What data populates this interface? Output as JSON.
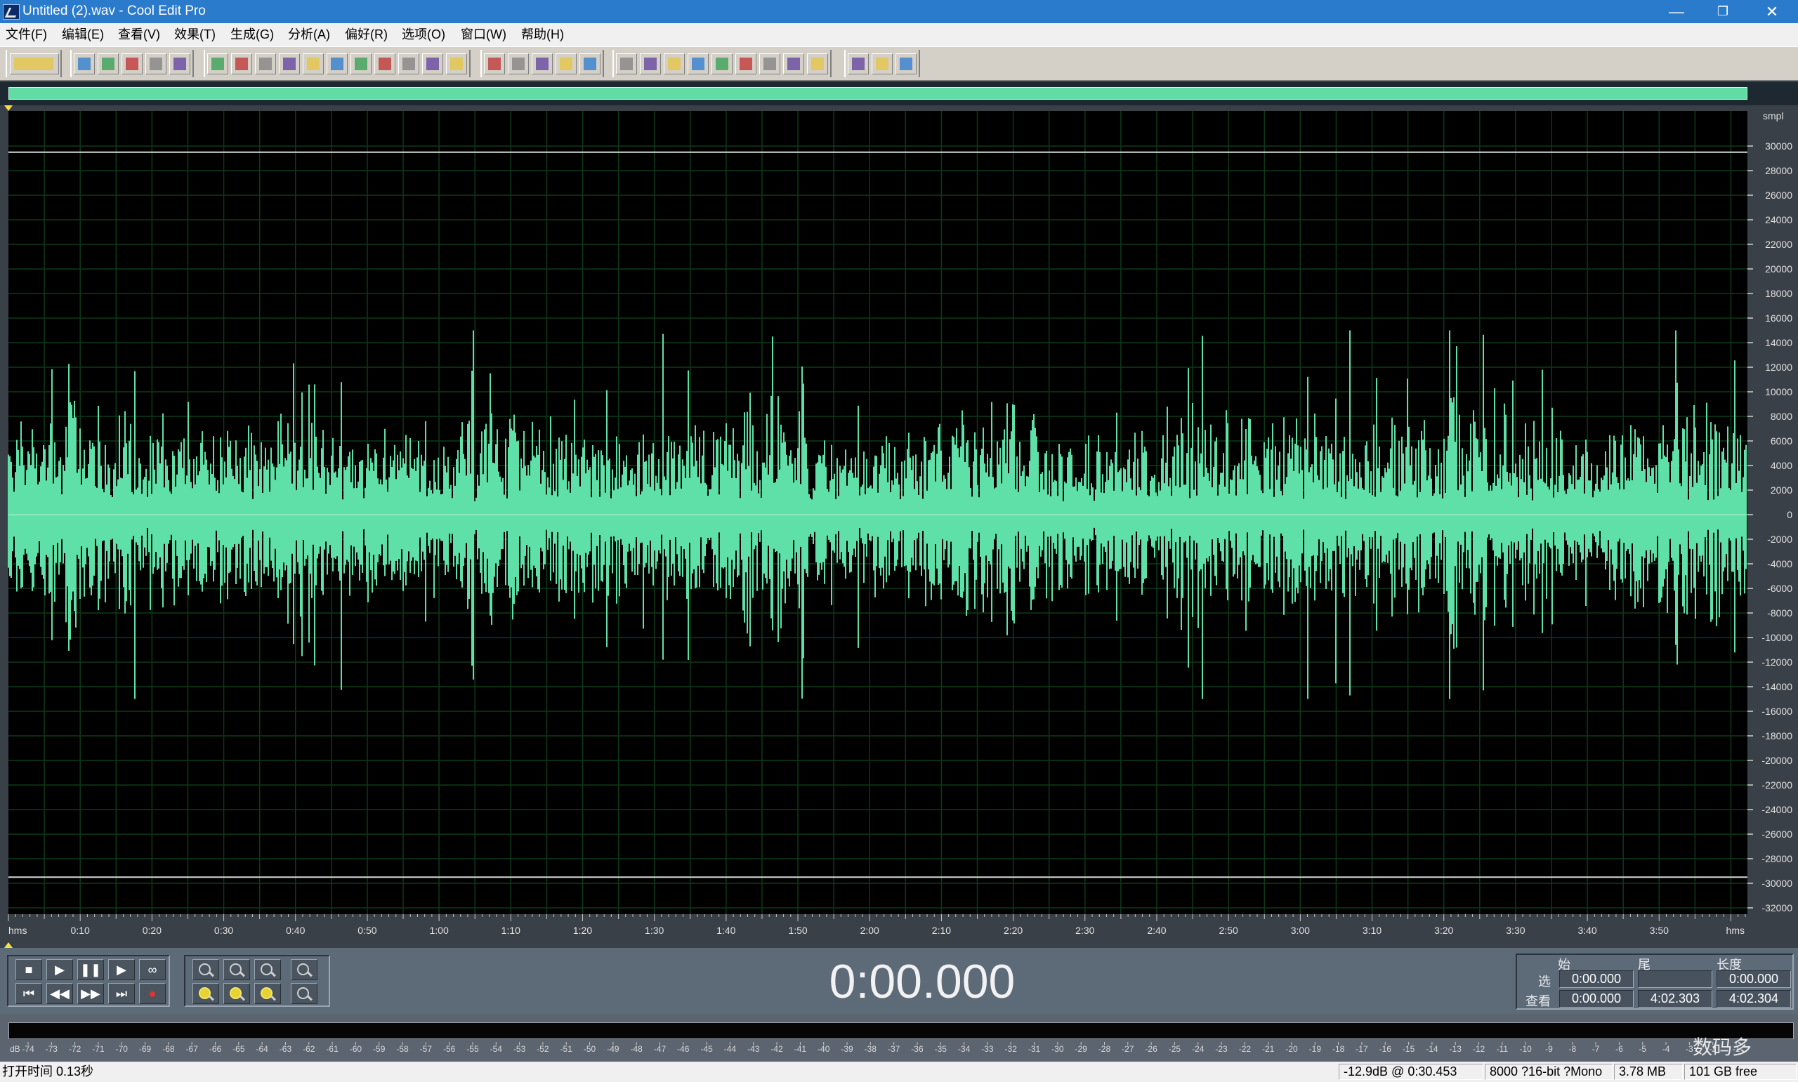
{
  "window": {
    "title": "Untitled (2).wav - Cool Edit Pro",
    "minimize": "—",
    "restore": "❐",
    "close": "✕"
  },
  "menu": [
    "文件(F)",
    "编辑(E)",
    "查看(V)",
    "效果(T)",
    "生成(G)",
    "分析(A)",
    "偏好(R)",
    "选项(O)",
    "窗口(W)",
    "帮助(H)"
  ],
  "toolbar": {
    "groups": [
      {
        "count": 1,
        "icons": [
          "multitrack-switch-icon"
        ]
      },
      {
        "count": 5,
        "icons": [
          "new-file-icon",
          "open-file-icon",
          "save-icon",
          "save-as-icon",
          "close-file-icon"
        ]
      },
      {
        "count": 11,
        "icons": [
          "undo-icon",
          "redo-icon",
          "repeat-icon",
          "copy-new-icon",
          "copy-icon",
          "cut-icon",
          "paste-icon",
          "paste-new-icon",
          "mix-paste-icon",
          "trim-icon",
          "crop-icon"
        ]
      },
      {
        "count": 5,
        "icons": [
          "spectral-view-icon",
          "frequency-analysis-icon",
          "grid-icon",
          "grid-alt-icon",
          "grid-alt2-icon"
        ]
      },
      {
        "count": 9,
        "icons": [
          "window-icon",
          "cue-list-icon",
          "play-list-icon",
          "play-icon",
          "zoom-icon",
          "time-icon",
          "info-icon",
          "colors-icon",
          "panel-icon"
        ]
      },
      {
        "count": 3,
        "icons": [
          "settings-icon",
          "scripts-icon",
          "help-icon"
        ]
      }
    ]
  },
  "colors": {
    "waveform": "#5fe0a8",
    "background": "#000000",
    "overview": "#60dca4",
    "gridline": "#0d3a18",
    "clipline": "#d8d8d8"
  },
  "waveform": {
    "y_unit": "smpl",
    "y_ticks": [
      "30000",
      "28000",
      "26000",
      "24000",
      "22000",
      "20000",
      "18000",
      "16000",
      "14000",
      "12000",
      "10000",
      "8000",
      "6000",
      "4000",
      "2000",
      "0",
      "-2000",
      "-4000",
      "-6000",
      "-8000",
      "-10000",
      "-12000",
      "-14000",
      "-16000",
      "-18000",
      "-20000",
      "-22000",
      "-24000",
      "-26000",
      "-28000",
      "-30000",
      "-32000"
    ],
    "x_unit": "hms",
    "x_ticks": [
      "0:10",
      "0:20",
      "0:30",
      "0:40",
      "0:50",
      "1:00",
      "1:10",
      "1:20",
      "1:30",
      "1:40",
      "1:50",
      "2:00",
      "2:10",
      "2:20",
      "2:30",
      "2:40",
      "2:50",
      "3:00",
      "3:10",
      "3:20",
      "3:30",
      "3:40",
      "3:50"
    ],
    "duration_s": 242.304,
    "clip_level": 29500,
    "peak_level_shown": 15000
  },
  "transport": {
    "time": "0:00.000",
    "buttons": [
      "stop",
      "play",
      "pause",
      "play-looped",
      "loop"
    ],
    "buttons2": [
      "go-to-start",
      "rewind",
      "fast-forward",
      "go-to-end",
      "record"
    ]
  },
  "selection": {
    "headers": [
      "始",
      "尾",
      "长度"
    ],
    "row1_label": "选",
    "row2_label": "查看",
    "sel_begin": "0:00.000",
    "sel_end": "",
    "sel_length": "0:00.000",
    "view_begin": "0:00.000",
    "view_end": "4:02.303",
    "view_length": "4:02.304"
  },
  "level_meter": {
    "label": "dB",
    "ticks": [
      "-74",
      "-73",
      "-72",
      "-71",
      "-70",
      "-69",
      "-68",
      "-67",
      "-66",
      "-65",
      "-64",
      "-63",
      "-62",
      "-61",
      "-60",
      "-59",
      "-58",
      "-57",
      "-56",
      "-55",
      "-54",
      "-53",
      "-52",
      "-51",
      "-50",
      "-49",
      "-48",
      "-47",
      "-46",
      "-45",
      "-44",
      "-43",
      "-42",
      "-41",
      "-40",
      "-39",
      "-38",
      "-37",
      "-36",
      "-35",
      "-34",
      "-33",
      "-32",
      "-31",
      "-30",
      "-29",
      "-28",
      "-27",
      "-26",
      "-25",
      "-24",
      "-23",
      "-22",
      "-21",
      "-20",
      "-19",
      "-18",
      "-17",
      "-16",
      "-15",
      "-14",
      "-13",
      "-12",
      "-11",
      "-10",
      "-9",
      "-8",
      "-7",
      "-6",
      "-5",
      "-4",
      "-3",
      "-2",
      "-1"
    ]
  },
  "status": {
    "open_time": "打开时间 0.13秒",
    "cursor_level": "-12.9dB @  0:30.453",
    "format": "8000 ?16-bit ?Mono",
    "size": "3.78 MB",
    "free": "101 GB free"
  },
  "watermark": "数码多"
}
